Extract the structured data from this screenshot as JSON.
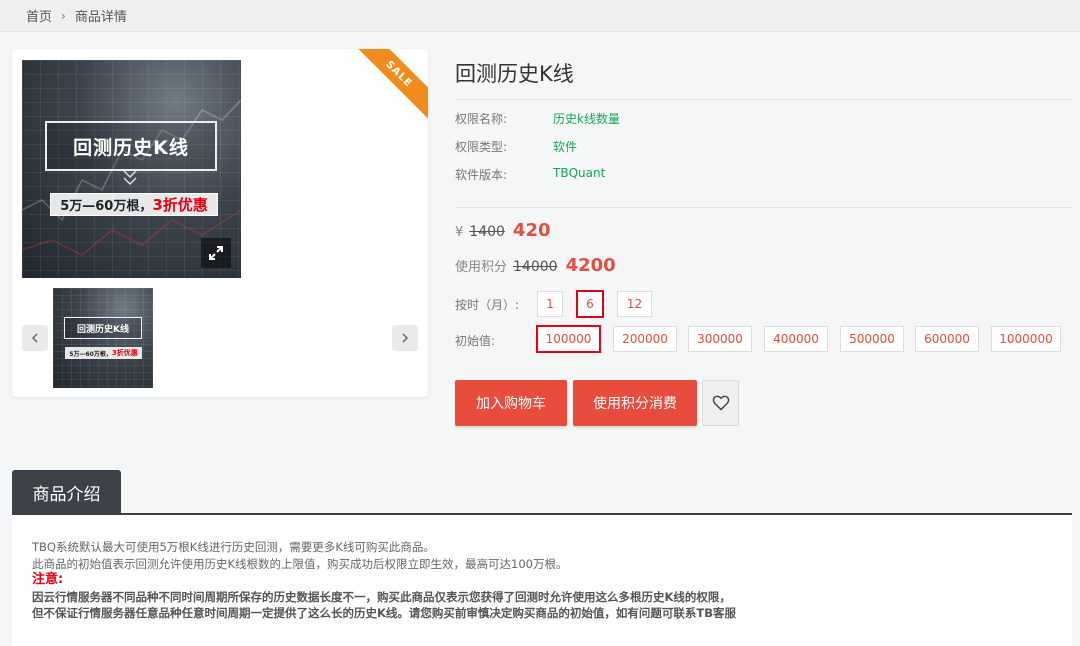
{
  "breadcrumb": {
    "home": "首页",
    "separator": "›",
    "current": "商品详情"
  },
  "gallery": {
    "ribbon": "SALE",
    "image_title": "回测历史K线",
    "image_promo_prefix": "5万—60万根，",
    "image_promo_highlight": "3折优惠",
    "thumb_title": "回测历史K线",
    "thumb_promo_prefix": "5万—60万根，",
    "thumb_promo_highlight": "3折优惠",
    "prev_icon": "chevron-left-icon",
    "next_icon": "chevron-right-icon",
    "expand_icon": "expand-icon"
  },
  "product": {
    "title": "回测历史K线",
    "attributes": [
      {
        "label": "权限名称:",
        "value": "历史k线数量"
      },
      {
        "label": "权限类型:",
        "value": "软件"
      },
      {
        "label": "软件版本:",
        "value": "TBQuant"
      }
    ],
    "price": {
      "currency": "¥",
      "original": "1400",
      "current": "420"
    },
    "points": {
      "label": "使用积分",
      "original": "14000",
      "current": "4200"
    },
    "duration": {
      "label": "按时（月）:",
      "options": [
        "1",
        "6",
        "12"
      ],
      "selected": "6"
    },
    "initial": {
      "label": "初始值:",
      "options": [
        "100000",
        "200000",
        "300000",
        "400000",
        "500000",
        "600000",
        "1000000"
      ],
      "selected": "100000"
    },
    "actions": {
      "add_to_cart": "加入购物车",
      "use_points": "使用积分消费",
      "favorite_icon": "heart-icon"
    }
  },
  "intro": {
    "tab": "商品介绍",
    "line1": "TBQ系统默认最大可使用5万根K线进行历史回测，需要更多K线可购买此商品。",
    "line2": "此商品的初始值表示回测允许使用历史K线根数的上限值，购买成功后权限立即生效，最高可达100万根。",
    "note_label": "注意:",
    "warning1": "因云行情服务器不同品种不同时间周期所保存的历史数据长度不一，购买此商品仅表示您获得了回测时允许使用这么多根历史K线的权限，",
    "warning2": "但不保证行情服务器任意品种任意时间周期一定提供了这么长的历史K线。请您购买前审慎决定购买商品的初始值，如有问题可联系TB客服"
  },
  "colors": {
    "accent": "#e74c3c",
    "green": "#19a35a",
    "ribbon": "#f08c1e",
    "dark_tab": "#3d4148"
  }
}
